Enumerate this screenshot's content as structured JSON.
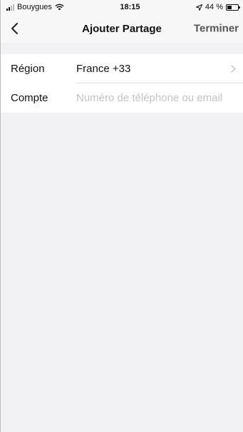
{
  "status_bar": {
    "carrier": "Bouygues",
    "time": "18:15",
    "battery_text": "44 %",
    "battery_level": 0.44
  },
  "nav": {
    "title": "Ajouter Partage",
    "done_label": "Terminer",
    "back_icon": "chevron-left-icon"
  },
  "form": {
    "region": {
      "label": "Région",
      "value": "France +33",
      "icon": "chevron-right-icon"
    },
    "account": {
      "label": "Compte",
      "value": "",
      "placeholder": "Numéro de téléphone ou email"
    }
  },
  "colors": {
    "background": "#f2f2f5",
    "bar": "#f7f7f8",
    "placeholder": "#c4c4c8",
    "done": "#555555"
  }
}
